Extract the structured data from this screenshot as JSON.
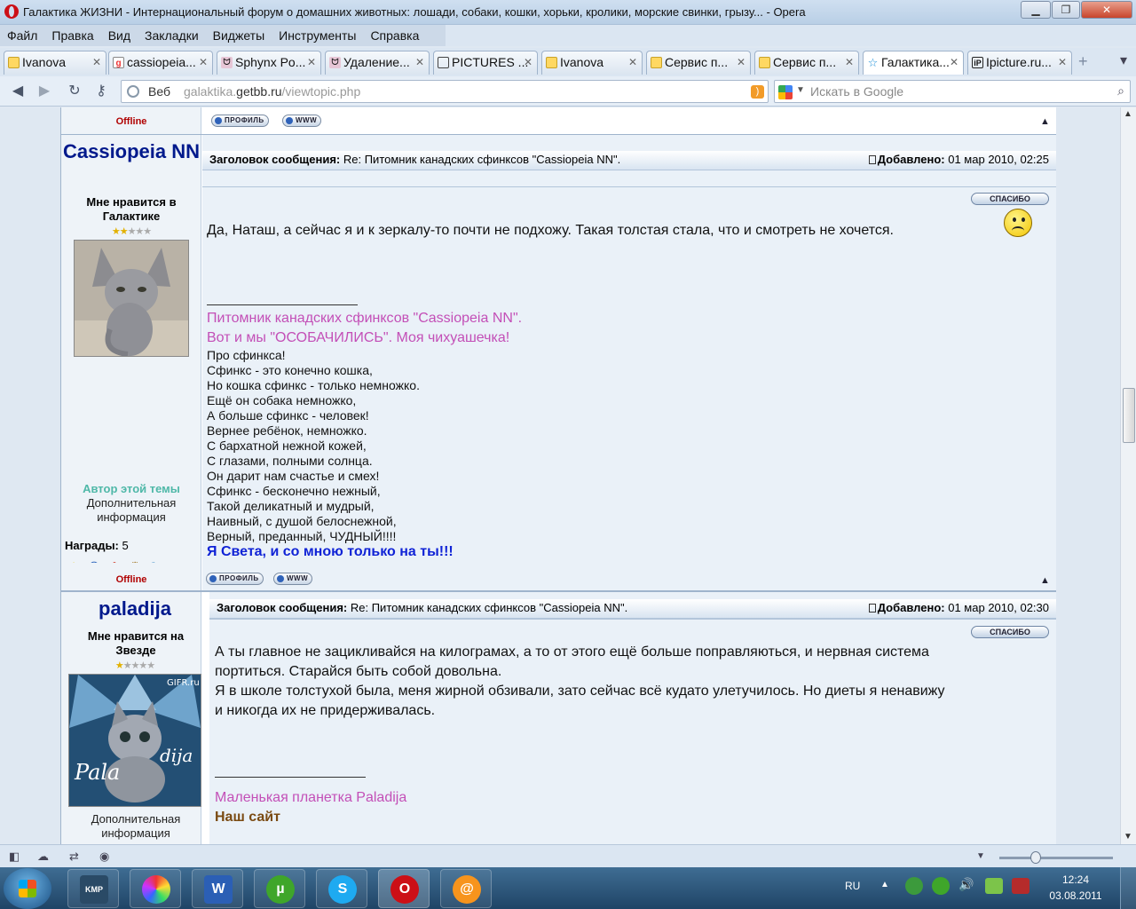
{
  "window": {
    "title": "Галактика ЖИЗНИ - Интернациональный форум о домашних животных: лошади, собаки, кошки, хорьки, кролики, морские свинки, грызу... - Opera"
  },
  "menu": [
    "Файл",
    "Правка",
    "Вид",
    "Закладки",
    "Виджеты",
    "Инструменты",
    "Справка"
  ],
  "tabs": [
    {
      "label": "Ivanova"
    },
    {
      "label": "cassiopeia..."
    },
    {
      "label": "Sphynx Po..."
    },
    {
      "label": "Удаление..."
    },
    {
      "label": "PICTURES ..."
    },
    {
      "label": "Ivanova"
    },
    {
      "label": "Сервис п..."
    },
    {
      "label": "Сервис п..."
    },
    {
      "label": "Галактика..."
    },
    {
      "label": "Ipicture.ru..."
    }
  ],
  "address": {
    "mode": "Веб",
    "url_prefix": "galaktika.",
    "url_domain": "getbb.ru",
    "url_path": "/viewtopic.php",
    "search_placeholder": "Искать в Google"
  },
  "post0": {
    "status": "Offline",
    "profile_btn": "ПРОФИЛЬ",
    "www_btn": "WWW"
  },
  "post1": {
    "username": "Cassiopeia NN",
    "rank": "Мне нравится в Галактике",
    "stars_on": 2,
    "stars_total": 5,
    "author_label": "Автор этой темы",
    "extra_label": "Дополнительная информация",
    "awards_label": "Награды:",
    "awards_count": "5",
    "status": "Offline",
    "subject_label": "Заголовок сообщения:",
    "subject": "Re: Питомник канадских сфинксов \"Cassiopeia NN\".",
    "added_label": "Добавлено:",
    "added_date": "01 мар 2010, 02:25",
    "thanks_btn": "СПАСИБО",
    "message": "Да, Наташ, а сейчас я и к зеркалу-то почти не подхожу. Такая толстая стала, что и смотреть не хочется.",
    "sig_link1": "Питомник канадских сфинксов \"Cassiopeia NN\".",
    "sig_link2": "Вот и мы \"ОСОБАЧИЛИСЬ\". Моя чихуашечка!",
    "poem": [
      "Про сфинкса!",
      "Сфинкс - это конечно кошка,",
      "Но кошка сфинкс - только немножко.",
      "Ещё он собака немножко,",
      "А больше сфинкс - человек!",
      "Вернее ребёнок, немножко.",
      "С бархатной нежной кожей,",
      "С глазами, полными солнца.",
      "Он дарит нам счастье и смех!",
      "Сфинкс - бесконечно нежный,",
      "Такой деликатный и мудрый,",
      "Наивный, с душой белоснежной,",
      "Верный, преданный, ЧУДНЫЙ!!!!"
    ],
    "sig_bold": "Я Света, и со мною только на ты!!!",
    "profile_btn": "ПРОФИЛЬ",
    "www_btn": "WWW"
  },
  "post2": {
    "username": "paladija",
    "rank": "Мне нравится на Звезде",
    "stars_on": 1,
    "stars_total": 5,
    "avatar_caption": "GIFR.ru",
    "avatar_text": "Pala dija",
    "extra_label": "Дополнительная информация",
    "subject_label": "Заголовок сообщения:",
    "subject": "Re: Питомник канадских сфинксов \"Cassiopeia NN\".",
    "added_label": "Добавлено:",
    "added_date": "01 мар 2010, 02:30",
    "thanks_btn": "СПАСИБО",
    "message_lines": [
      "А ты главное не зацикливайся на килограмах, а то от этого ещё больше поправляються, и нервная система",
      "портиться. Старайся быть собой довольна.",
      "Я в школе толстухой была, меня жирной обзивали, зато сейчас всё кудато улетучилось. Но диеты я ненавижу",
      "и никогда их не придерживалась."
    ],
    "sig_link": "Маленькая планетка Paladija",
    "sig_bold": "Наш сайт"
  },
  "taskbar": {
    "apps": [
      "KMP",
      "media",
      "W",
      "µTorrent",
      "Skype",
      "Opera",
      "@"
    ],
    "lang": "RU",
    "time": "12:24",
    "date": "03.08.2011"
  },
  "colors": {
    "username": "#00198c",
    "signature_link": "#c34fb7",
    "offline": "#b00000",
    "author": "#4fb8a8"
  }
}
